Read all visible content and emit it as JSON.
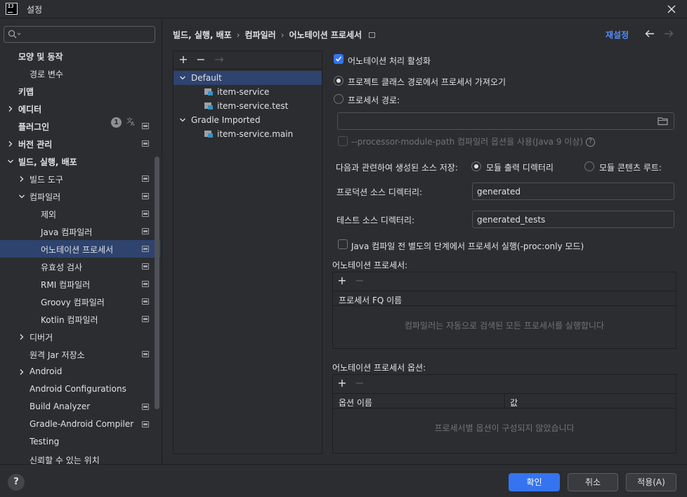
{
  "window": {
    "title": "설정",
    "logo_text": "IJ"
  },
  "sidebar": {
    "search_placeholder": "",
    "items": [
      {
        "label": "모양 및 동작",
        "bold": true,
        "chevron": "none"
      },
      {
        "label": "경로 변수",
        "bold": false,
        "chevron": "none"
      },
      {
        "label": "키맵",
        "bold": true,
        "chevron": "none"
      },
      {
        "label": "에디터",
        "bold": true,
        "chevron": "right"
      },
      {
        "label": "플러그인",
        "bold": true,
        "chevron": "none",
        "badge": "1"
      },
      {
        "label": "버전 관리",
        "bold": true,
        "chevron": "right"
      },
      {
        "label": "빌드, 실행, 배포",
        "bold": true,
        "chevron": "down"
      },
      {
        "label": "빌드 도구",
        "bold": false,
        "chevron": "right"
      },
      {
        "label": "컴파일러",
        "bold": false,
        "chevron": "down"
      },
      {
        "label": "제외",
        "bold": false,
        "chevron": "none"
      },
      {
        "label": "Java 컴파일러",
        "bold": false,
        "chevron": "none"
      },
      {
        "label": "어노테이션 프로세서",
        "bold": false,
        "chevron": "none",
        "selected": true
      },
      {
        "label": "유효성 검사",
        "bold": false,
        "chevron": "none"
      },
      {
        "label": "RMI 컴파일러",
        "bold": false,
        "chevron": "none"
      },
      {
        "label": "Groovy 컴파일러",
        "bold": false,
        "chevron": "none"
      },
      {
        "label": "Kotlin 컴파일러",
        "bold": false,
        "chevron": "none"
      },
      {
        "label": "디버거",
        "bold": false,
        "chevron": "right"
      },
      {
        "label": "원격 Jar 저장소",
        "bold": false,
        "chevron": "none"
      },
      {
        "label": "Android",
        "bold": false,
        "chevron": "right"
      },
      {
        "label": "Android Configurations",
        "bold": false,
        "chevron": "none"
      },
      {
        "label": "Build Analyzer",
        "bold": false,
        "chevron": "none"
      },
      {
        "label": "Gradle-Android Compiler",
        "bold": false,
        "chevron": "none"
      },
      {
        "label": "Testing",
        "bold": false,
        "chevron": "none"
      },
      {
        "label": "신뢰할 수 있는 위치",
        "bold": false,
        "chevron": "none"
      }
    ]
  },
  "header": {
    "breadcrumb": [
      "빌드, 실행, 배포",
      "컴파일러",
      "어노테이션 프로세서"
    ],
    "reset_label": "재설정",
    "sep": "›"
  },
  "profiles": {
    "toolbar": {
      "add": "+",
      "remove": "−",
      "move": "→"
    },
    "tree": [
      {
        "label": "Default",
        "kind": "group",
        "selected": true
      },
      {
        "label": "item-service",
        "kind": "module"
      },
      {
        "label": "item-service.test",
        "kind": "module"
      },
      {
        "label": "Gradle Imported",
        "kind": "group"
      },
      {
        "label": "item-service.main",
        "kind": "module"
      }
    ]
  },
  "settings": {
    "enable_processing": {
      "label": "어노테이션 처리 활성화",
      "checked": true
    },
    "source_option_classpath": {
      "label": "프로젝트 클래스 경로에서 프로세서 가져오기",
      "selected": true
    },
    "source_option_path": {
      "label": "프로세서 경로:",
      "selected": false
    },
    "processor_path_value": "",
    "module_path_option": {
      "label": "--processor-module-path 컴파일러 옵션을 사용(Java 9 이상)",
      "help": "?",
      "checked": false
    },
    "store_label": "다음과 관련하여 생성된 소스 저장:",
    "store_module_output": {
      "label": "모듈 출력 디렉터리",
      "selected": true
    },
    "store_content_root": {
      "label": "모듈 콘텐츠 루트:",
      "selected": false
    },
    "production_dir_label": "프로덕션 소스 디렉터리:",
    "production_dir_value": "generated",
    "test_dir_label": "테스트 소스 디렉터리:",
    "test_dir_value": "generated_tests",
    "proc_only": {
      "label": "Java 컴파일 전 별도의 단계에서 프로세서 실행(-proc:only 모드)",
      "checked": false
    }
  },
  "processors_table": {
    "title": "어노테이션 프로세서:",
    "add": "+",
    "remove": "−",
    "header": "프로세서 FQ 이름",
    "empty_text": "컴파일러는 자동으로 검색된 모든 프로세서를 실행합니다"
  },
  "options_table": {
    "title": "어노테이션 프로세서 옵션:",
    "add": "+",
    "remove": "−",
    "header_name": "옵션 이름",
    "header_value": "값",
    "empty_text": "프로세서별 옵션이 구성되지 않았습니다"
  },
  "footer": {
    "help": "?",
    "ok": "확인",
    "cancel": "취소",
    "apply": "적용(A)"
  },
  "colors": {
    "accent": "#3574f0",
    "link": "#548af7",
    "selection": "#2e436e",
    "background": "#2b2d30"
  }
}
